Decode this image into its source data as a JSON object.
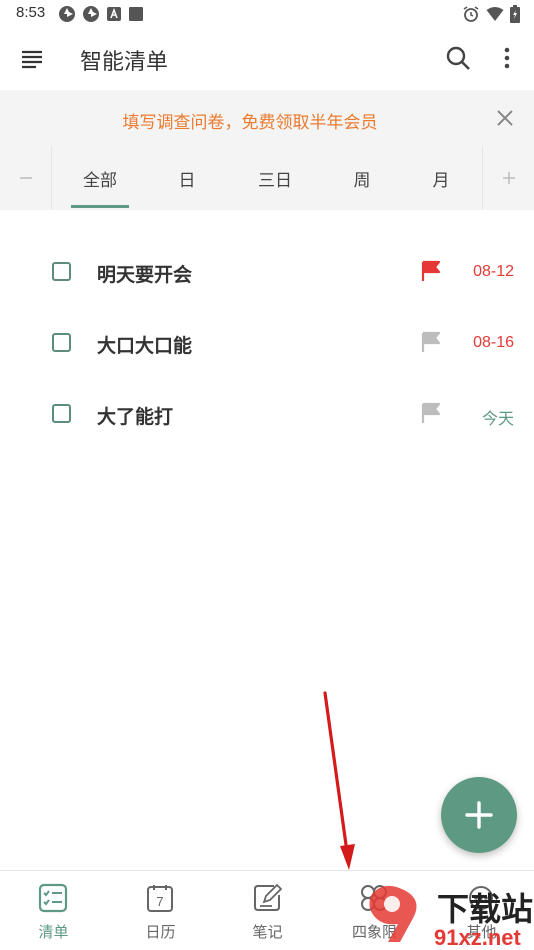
{
  "status_bar": {
    "time": "8:53"
  },
  "app_bar": {
    "title": "智能清单"
  },
  "banner": {
    "text": "填写调查问卷，免费领取半年会员"
  },
  "tabs": [
    {
      "label": "全部",
      "selected": true
    },
    {
      "label": "日",
      "selected": false
    },
    {
      "label": "三日",
      "selected": false
    },
    {
      "label": "周",
      "selected": false
    },
    {
      "label": "月",
      "selected": false
    }
  ],
  "tasks": [
    {
      "title": "明天要开会",
      "date": "08-12",
      "flag_color": "#e53935",
      "date_color": "#e53935"
    },
    {
      "title": "大口大口能",
      "date": "08-16",
      "flag_color": "#bdbdbd",
      "date_color": "#e53935"
    },
    {
      "title": "大了能打",
      "date": "今天",
      "flag_color": "#bdbdbd",
      "date_color": "#5e9a83"
    }
  ],
  "bottom_nav": [
    {
      "label": "清单",
      "icon": "checklist-icon",
      "active": true
    },
    {
      "label": "日历",
      "icon": "calendar-icon",
      "active": false,
      "icon_text": "7"
    },
    {
      "label": "笔记",
      "icon": "note-icon",
      "active": false
    },
    {
      "label": "四象限",
      "icon": "quadrant-icon",
      "active": false
    },
    {
      "label": "其他",
      "icon": "other-icon",
      "active": false
    }
  ],
  "watermark": {
    "text_main": "下载站",
    "text_sub": "91xz.net"
  },
  "colors": {
    "accent": "#5e9a83",
    "banner_text": "#ec7a2e",
    "red": "#e53935"
  }
}
